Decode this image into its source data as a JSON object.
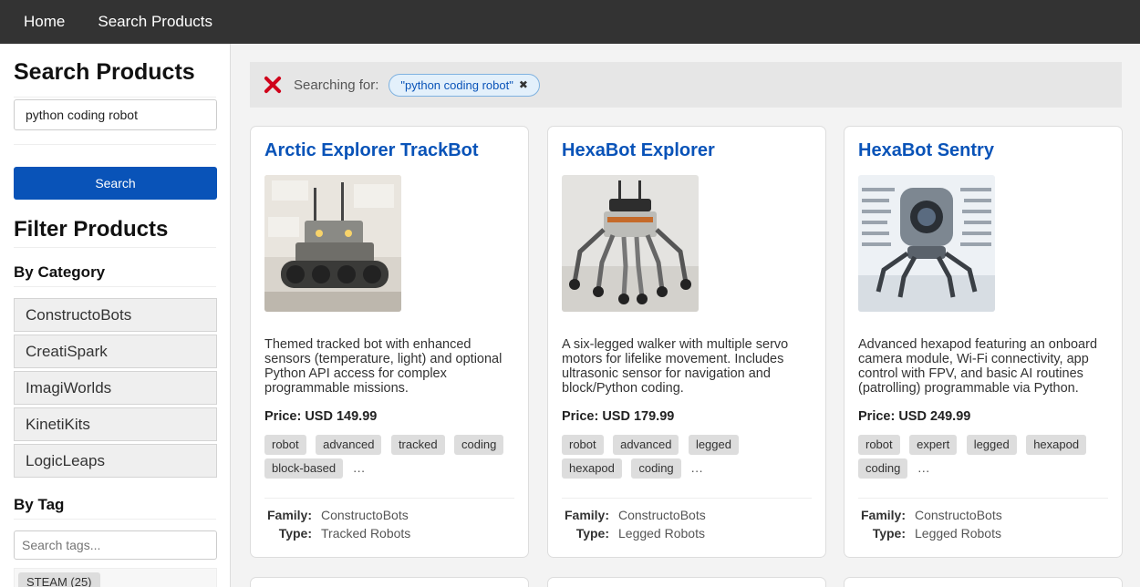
{
  "nav": {
    "home": "Home",
    "search_products": "Search Products"
  },
  "sidebar": {
    "title": "Search Products",
    "search_value": "python coding robot",
    "search_button": "Search",
    "filter_title": "Filter Products",
    "by_category": "By Category",
    "categories": [
      "ConstructoBots",
      "CreatiSpark",
      "ImagiWorlds",
      "KinetiKits",
      "LogicLeaps"
    ],
    "by_tag": "By Tag",
    "tag_placeholder": "Search tags...",
    "first_tag": "STEAM (25)"
  },
  "search": {
    "label": "Searching for:",
    "query": "\"python coding robot\"",
    "clear_glyph": "✖"
  },
  "products": [
    {
      "title": "Arctic Explorer TrackBot",
      "description": "Themed tracked bot with enhanced sensors (temperature, light) and optional Python API access for complex programmable missions.",
      "price": "Price: USD 149.99",
      "tags": [
        "robot",
        "advanced",
        "tracked",
        "coding",
        "block-based"
      ],
      "more": "…",
      "family_label": "Family:",
      "family": "ConstructoBots",
      "type_label": "Type:",
      "type": "Tracked Robots"
    },
    {
      "title": "HexaBot Explorer",
      "description": "A six-legged walker with multiple servo motors for lifelike movement. Includes ultrasonic sensor for navigation and block/Python coding.",
      "price": "Price: USD 179.99",
      "tags": [
        "robot",
        "advanced",
        "legged",
        "hexapod",
        "coding"
      ],
      "more": "…",
      "family_label": "Family:",
      "family": "ConstructoBots",
      "type_label": "Type:",
      "type": "Legged Robots"
    },
    {
      "title": "HexaBot Sentry",
      "description": "Advanced hexapod featuring an onboard camera module, Wi-Fi connectivity, app control with FPV, and basic AI routines (patrolling) programmable via Python.",
      "price": "Price: USD 249.99",
      "tags": [
        "robot",
        "expert",
        "legged",
        "hexapod",
        "coding"
      ],
      "more": "…",
      "family_label": "Family:",
      "family": "ConstructoBots",
      "type_label": "Type:",
      "type": "Legged Robots"
    }
  ]
}
